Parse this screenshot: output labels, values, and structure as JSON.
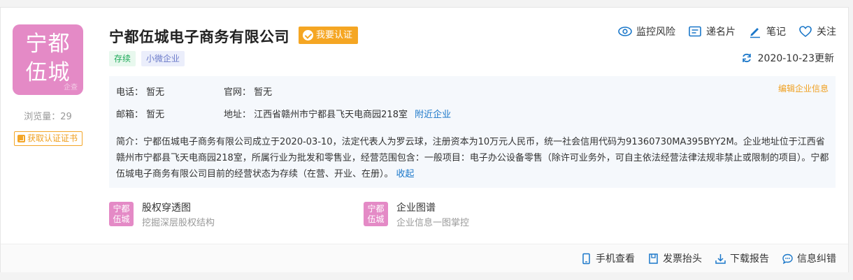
{
  "company": {
    "logo_text_line1": "宁都",
    "logo_text_line2": "伍城",
    "logo_watermark": "企查",
    "name": "宁都伍城电子商务有限公司",
    "verify_label": "我要认证",
    "tags": [
      "存续",
      "小微企业"
    ],
    "views_label": "浏览量：29",
    "cert_button_label": "获取认证证书"
  },
  "actions": {
    "monitor": "监控风险",
    "card": "递名片",
    "note": "笔记",
    "follow": "关注"
  },
  "updated": "2020-10-23更新",
  "info": {
    "phone_label": "电话：",
    "phone_value": "暂无",
    "website_label": "官网：",
    "website_value": "暂无",
    "email_label": "邮箱：",
    "email_value": "暂无",
    "address_label": "地址：",
    "address_value": "江西省赣州市宁都县飞天电商园218室",
    "nearby_link": "附近企业",
    "edit_link": "编辑企业信息",
    "intro_label": "简介：",
    "intro_text": "宁都伍城电子商务有限公司成立于2020-03-10，法定代表人为罗云球，注册资本为10万元人民币，统一社会信用代码为91360730MA395BYY2M。企业地址位于江西省赣州市宁都县飞天电商园218室，所属行业为批发和零售业，经营范围包含：一般项目：电子办公设备零售（除许可业务外，可自主依法经营法律法规非禁止或限制的项目）。宁都伍城电子商务有限公司目前的经营状态为存续（在营、开业、在册）。",
    "collapse_link": "收起"
  },
  "features": [
    {
      "icon_line1": "宁都",
      "icon_line2": "伍城",
      "title": "股权穿透图",
      "subtitle": "挖掘深层股权结构"
    },
    {
      "icon_line1": "宁都",
      "icon_line2": "伍城",
      "title": "企业图谱",
      "subtitle": "企业信息一图掌控"
    }
  ],
  "bottom": {
    "mobile": "手机查看",
    "invoice": "发票抬头",
    "download": "下载报告",
    "correct": "信息纠错"
  },
  "colors": {
    "accent_blue": "#1a77c9",
    "orange": "#f5a623",
    "logo_pink": "#e48ac6",
    "status_green": "#1eaa59"
  }
}
